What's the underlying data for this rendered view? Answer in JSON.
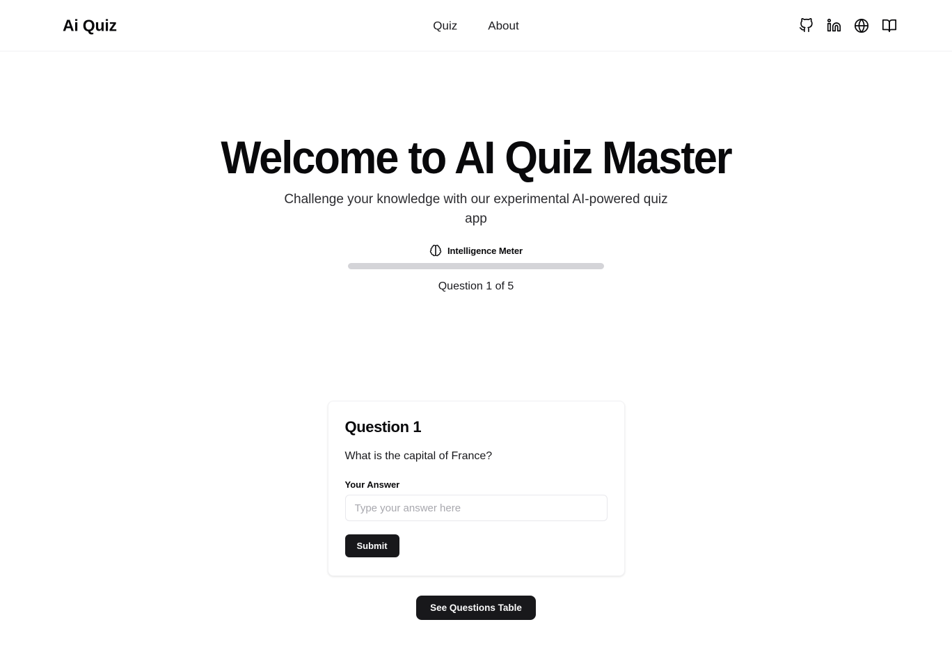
{
  "header": {
    "brand": "Ai Quiz",
    "nav": [
      {
        "label": "Quiz",
        "name": "nav-link-quiz"
      },
      {
        "label": "About",
        "name": "nav-link-about"
      }
    ],
    "social": [
      {
        "icon": "github-icon"
      },
      {
        "icon": "linkedin-icon"
      },
      {
        "icon": "globe-icon"
      },
      {
        "icon": "book-icon"
      }
    ]
  },
  "hero": {
    "title": "Welcome to AI Quiz Master",
    "subtitle": "Challenge your knowledge with our experimental AI-powered quiz app"
  },
  "progress": {
    "icon": "brain-icon",
    "label": "Intelligence Meter",
    "percent": 0,
    "caption": "Question 1 of 5",
    "current_question": 1,
    "total_questions": 5,
    "track_color": "#d4d4d8",
    "fill_color": "#18181b"
  },
  "question_card": {
    "title": "Question 1",
    "question": "What is the capital of France?",
    "answer_label": "Your Answer",
    "answer_value": "",
    "answer_placeholder": "Type your answer here",
    "submit_label": "Submit"
  },
  "footer_actions": {
    "see_table_label": "See Questions Table"
  },
  "theme": {
    "background": "#ffffff",
    "foreground": "#09090b",
    "accent": "#18181b",
    "muted": "#a8a8ae",
    "border": "#e8e8ec"
  }
}
